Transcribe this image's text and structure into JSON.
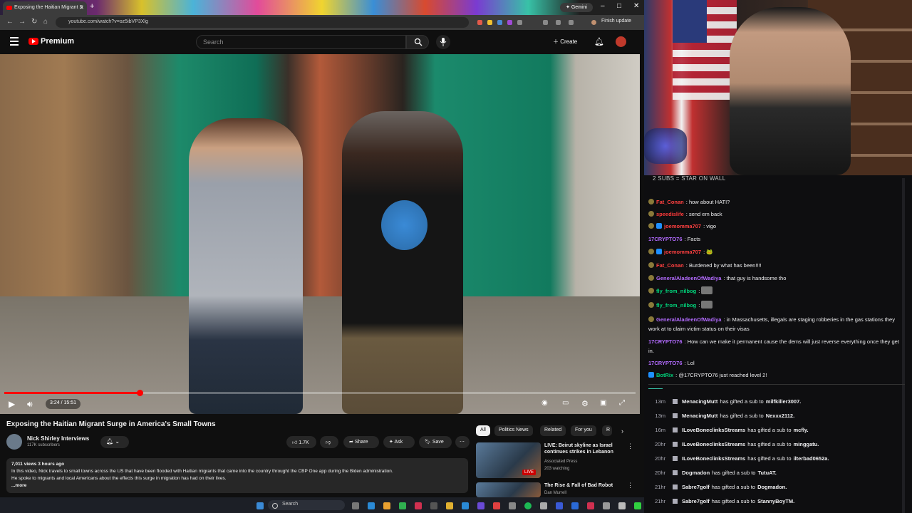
{
  "browser": {
    "tab_title": "Exposing the Haitian Migrant S",
    "gemini_label": "Gemini",
    "url": "youtube.com/watch?v=oz5ibVP3Xlg",
    "finish_update": "Finish update"
  },
  "youtube": {
    "logo_label": "Premium",
    "search_placeholder": "Search",
    "create_label": "Create",
    "video": {
      "time": "3:24 / 15:51",
      "progress": 0.215,
      "title": "Exposing the Haitian Migrant Surge in America's Small Towns",
      "channel": "Nick Shirley Interviews",
      "subscribers": "117K subscribers",
      "likes": "1.7K",
      "share_label": "Share",
      "ask_label": "Ask",
      "save_label": "Save",
      "stats": "7,011 views  3 hours ago",
      "description_1": "In this video, Nick travels to small towns across the US that have been flooded with Haitian migrants that came into the country throught the CBP One app during the Biden administration.",
      "description_2": "He spoke to migrants and local Americans about the effects this surge in migration has had on their lives.",
      "more": "...more"
    },
    "chips": [
      "All",
      "Politics News",
      "Related",
      "For you",
      "R"
    ],
    "recommendations": [
      {
        "title": "LIVE: Beirut skyline as Israel continues strikes in Lebanon",
        "channel": "Associated Press",
        "meta": "203 watching",
        "badge": "LIVE"
      },
      {
        "title": "The Rise & Fall of Bad Robot",
        "channel": "Dan Murrell",
        "meta": ""
      }
    ]
  },
  "taskbar": {
    "search_label": "Search"
  },
  "stream": {
    "banner": "2 SUBS = STAR ON WALL",
    "chat": [
      {
        "user": "Fat_Conan",
        "color": "#ff4040",
        "text": "how about HATI?",
        "badge": "round"
      },
      {
        "user": "speedislife",
        "color": "#ff3a3a",
        "text": "send em back",
        "badge": "round"
      },
      {
        "user": "joemomma707",
        "color": "#ff4040",
        "text": "vigo",
        "badge": "both"
      },
      {
        "user": "17CRYPTO76",
        "color": "#b36bff",
        "text": "Facts",
        "badge": "none"
      },
      {
        "user": "joemomma707",
        "color": "#ff4040",
        "text": "🐸",
        "badge": "both"
      },
      {
        "user": "Fat_Conan",
        "color": "#ff4040",
        "text": "Burdened by what has been!!!!",
        "badge": "round"
      },
      {
        "user": "GeneralAladeenOfWadiya",
        "color": "#b36bff",
        "text": "that guy is handsome tho",
        "badge": "round"
      },
      {
        "user": "fly_from_nilbog",
        "color": "#00d37a",
        "text": "",
        "badge": "round"
      },
      {
        "user": "fly_from_nilbog",
        "color": "#00d37a",
        "text": "",
        "badge": "round"
      },
      {
        "user": "GeneralAladeenOfWadiya",
        "color": "#b36bff",
        "text": "in Massachusetts, illegals are staging robberies in the gas stations they work at to claim victim status on their visas",
        "badge": "round"
      },
      {
        "user": "17CRYPTO76",
        "color": "#b36bff",
        "text": "How can we make it permanent cause the dems will just reverse everything once they get in.",
        "badge": "none"
      },
      {
        "user": "17CRYPTO76",
        "color": "#b36bff",
        "text": "Lol",
        "badge": "none"
      },
      {
        "user": "BotRix",
        "color": "#00d37a",
        "text": "@17CRYPTO76 just reached level 2!",
        "badge": "bot"
      }
    ],
    "gifts": [
      {
        "time": "13m",
        "user": "MenacingMutt",
        "recipient": "milfkiller3007."
      },
      {
        "time": "13m",
        "user": "MenacingMutt",
        "recipient": "Nexxx2112."
      },
      {
        "time": "16m",
        "user": "ILoveBoneclinksStreams",
        "recipient": "mcfly."
      },
      {
        "time": "20hr",
        "user": "ILoveBoneclinksStreams",
        "recipient": "minggatu."
      },
      {
        "time": "20hr",
        "user": "ILoveBoneclinksStreams",
        "recipient": "ilterbad0652a."
      },
      {
        "time": "20hr",
        "user": "Dogmadon",
        "recipient": "TutuAT."
      },
      {
        "time": "21hr",
        "user": "Sabre7golf",
        "recipient": "Dogmadon."
      },
      {
        "time": "21hr",
        "user": "Sabre7golf",
        "recipient": "StannyBoyTM."
      }
    ],
    "gift_phrase": "has gifted a sub to"
  }
}
